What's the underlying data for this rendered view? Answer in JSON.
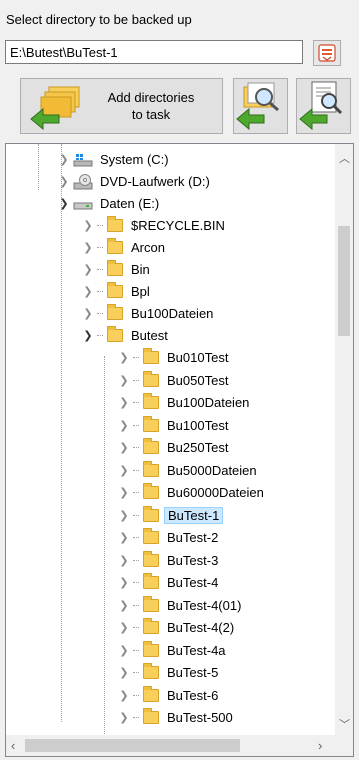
{
  "heading": "Select directory to be backed up",
  "path": {
    "value": "E:\\Butest\\BuTest-1"
  },
  "buttons": {
    "browse_icon": "drive-list-icon",
    "add_label": "Add directories\nto task",
    "add_icon": "folders-add-icon",
    "search_icon": "folder-search-icon",
    "report_icon": "document-search-icon"
  },
  "tree": {
    "drives": [
      {
        "label": "System (C:)",
        "icon": "windows-drive-icon"
      },
      {
        "label": "DVD-Laufwerk (D:)",
        "icon": "dvd-drive-icon"
      },
      {
        "label": "Daten (E:)",
        "icon": "drive-icon"
      }
    ],
    "e_folders": [
      "$RECYCLE.BIN",
      "Arcon",
      "Bin",
      "Bpl",
      "Bu100Dateien",
      "Butest"
    ],
    "butest_children": [
      "Bu010Test",
      "Bu050Test",
      "Bu100Dateien",
      "Bu100Test",
      "Bu250Test",
      "Bu5000Dateien",
      "Bu60000Dateien",
      "BuTest-1",
      "BuTest-2",
      "BuTest-3",
      "BuTest-4",
      "BuTest-4(01)",
      "BuTest-4(2)",
      "BuTest-4a",
      "BuTest-5",
      "BuTest-6",
      "BuTest-500"
    ],
    "selected": "BuTest-1"
  }
}
